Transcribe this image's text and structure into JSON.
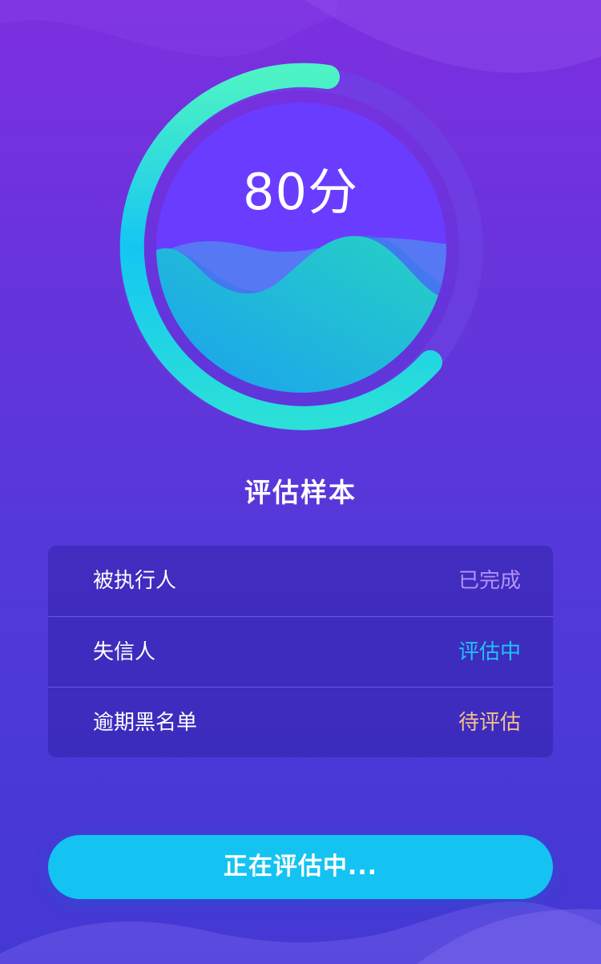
{
  "score": {
    "value": 80,
    "text": "80分",
    "progress_fraction": 0.8
  },
  "section": {
    "title": "评估样本"
  },
  "items": [
    {
      "label": "被执行人",
      "status": "已完成",
      "status_color": "#b292f7"
    },
    {
      "label": "失信人",
      "status": "评估中",
      "status_color": "#1fc2f6"
    },
    {
      "label": "逾期黑名单",
      "status": "待评估",
      "status_color": "#f4c28a"
    }
  ],
  "action": {
    "label": "正在评估中..."
  },
  "colors": {
    "ring_start": "#4df3c4",
    "ring_end": "#15c6f2",
    "inner_circle": "#6a3cff",
    "wave_front": "#1ec6d6",
    "button": "#14c3f2"
  }
}
